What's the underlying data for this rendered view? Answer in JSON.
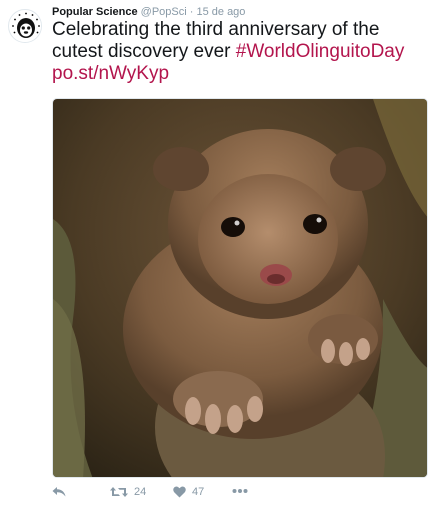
{
  "tweet": {
    "author_name": "Popular Science",
    "handle": "@PopSci",
    "separator": "·",
    "date": "15 de ago",
    "text_lines": [
      "Celebrating the third anniversary of the",
      "cutest discovery ever"
    ],
    "hashtag": "#WorldOlinguitoDay",
    "link": "po.st/nWyKyp",
    "image_icon": "olinguito-photo"
  },
  "actions": {
    "reply_icon": "reply-icon",
    "retweet_icon": "retweet-icon",
    "retweet_count": "24",
    "like_icon": "heart-icon",
    "like_count": "47",
    "more_icon": "more-icon"
  },
  "colors": {
    "text": "#14171a",
    "meta": "#8899a6",
    "link": "#b3154d"
  }
}
